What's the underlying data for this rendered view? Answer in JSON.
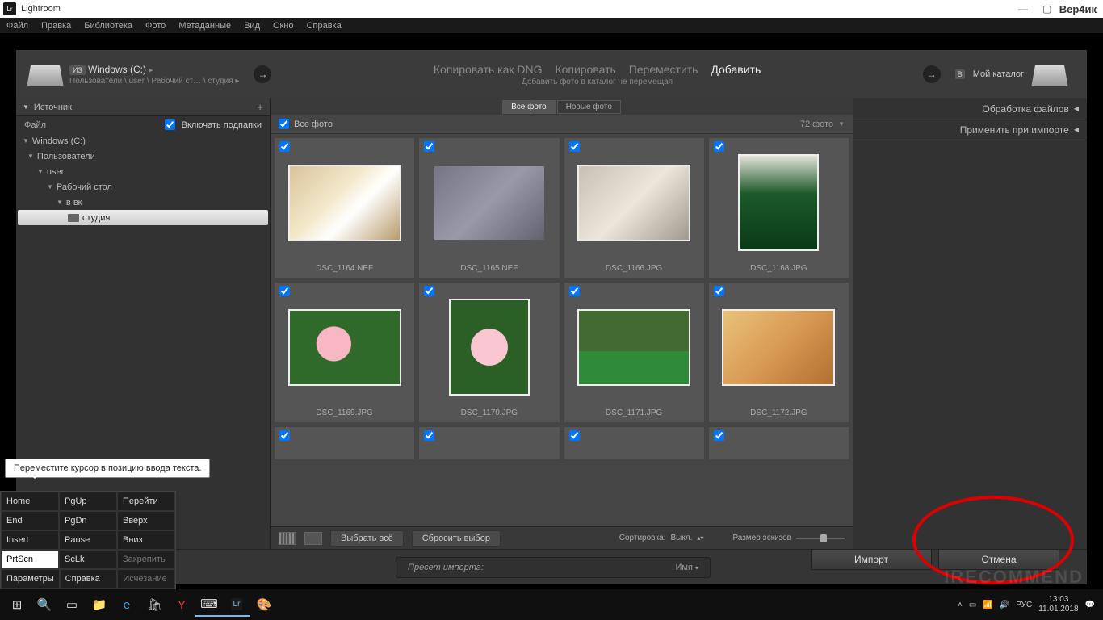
{
  "title_bar": {
    "app": "Lightroom",
    "user": "Вер4ик"
  },
  "menu": [
    "Файл",
    "Правка",
    "Библиотека",
    "Фото",
    "Метаданные",
    "Вид",
    "Окно",
    "Справка"
  ],
  "import": {
    "from_badge": "ИЗ",
    "source_name": "Windows (C:)",
    "source_path": "Пользователи \\ user \\ Рабочий ст… \\ студия ▸",
    "actions": {
      "dng": "Копировать как DNG",
      "copy": "Копировать",
      "move": "Переместить",
      "add": "Добавить"
    },
    "subtitle": "Добавить фото в каталог не перемещая",
    "to_badge": "В",
    "dest": "Мой каталог"
  },
  "source_panel": {
    "title": "Источник",
    "file_label": "Файл",
    "include_sub": "Включать подпапки"
  },
  "tree": {
    "root": "Windows (C:)",
    "n1": "Пользователи",
    "n2": "user",
    "n3": "Рабочий стол",
    "n4": "в вк",
    "n5": "студия"
  },
  "filter": {
    "all": "Все фото",
    "new": "Новые фото"
  },
  "allrow": {
    "label": "Все фото",
    "count": "72 фото"
  },
  "thumbs": [
    {
      "name": "DSC_1164.NEF",
      "g": "g1"
    },
    {
      "name": "DSC_1165.NEF",
      "g": "g2",
      "dim": true
    },
    {
      "name": "DSC_1166.JPG",
      "g": "g3"
    },
    {
      "name": "DSC_1168.JPG",
      "g": "g4",
      "portrait": true
    },
    {
      "name": "DSC_1169.JPG",
      "g": "g5"
    },
    {
      "name": "DSC_1170.JPG",
      "g": "g6",
      "portrait": true
    },
    {
      "name": "DSC_1171.JPG",
      "g": "g7"
    },
    {
      "name": "DSC_1172.JPG",
      "g": "g8"
    }
  ],
  "toolbar": {
    "select_all": "Выбрать всё",
    "deselect": "Сбросить выбор",
    "sort_label": "Сортировка:",
    "sort_value": "Выкл.",
    "size_label": "Размер эскизов"
  },
  "right_panel": {
    "r1": "Обработка файлов",
    "r2": "Применить при импорте"
  },
  "preset": {
    "label": "Пресет импорта:",
    "value": "Имя"
  },
  "buttons": {
    "import": "Импорт",
    "cancel": "Отмена"
  },
  "tooltip": "Переместите курсор в позицию ввода текста.",
  "osk": {
    "r1": [
      "Home",
      "PgUp",
      "Перейти"
    ],
    "r2": [
      "End",
      "PgDn",
      "Вверх"
    ],
    "r3": [
      "Insert",
      "Pause",
      "Вниз"
    ],
    "r4": [
      "PrtScn",
      "ScLk",
      "Закрепить"
    ],
    "r5": [
      "Параметры",
      "Справка",
      "Исчезание"
    ]
  },
  "tray": {
    "lang": "РУС",
    "time": "13:03",
    "date": "11.01.2018"
  },
  "watermark": "IRECOMMEND"
}
